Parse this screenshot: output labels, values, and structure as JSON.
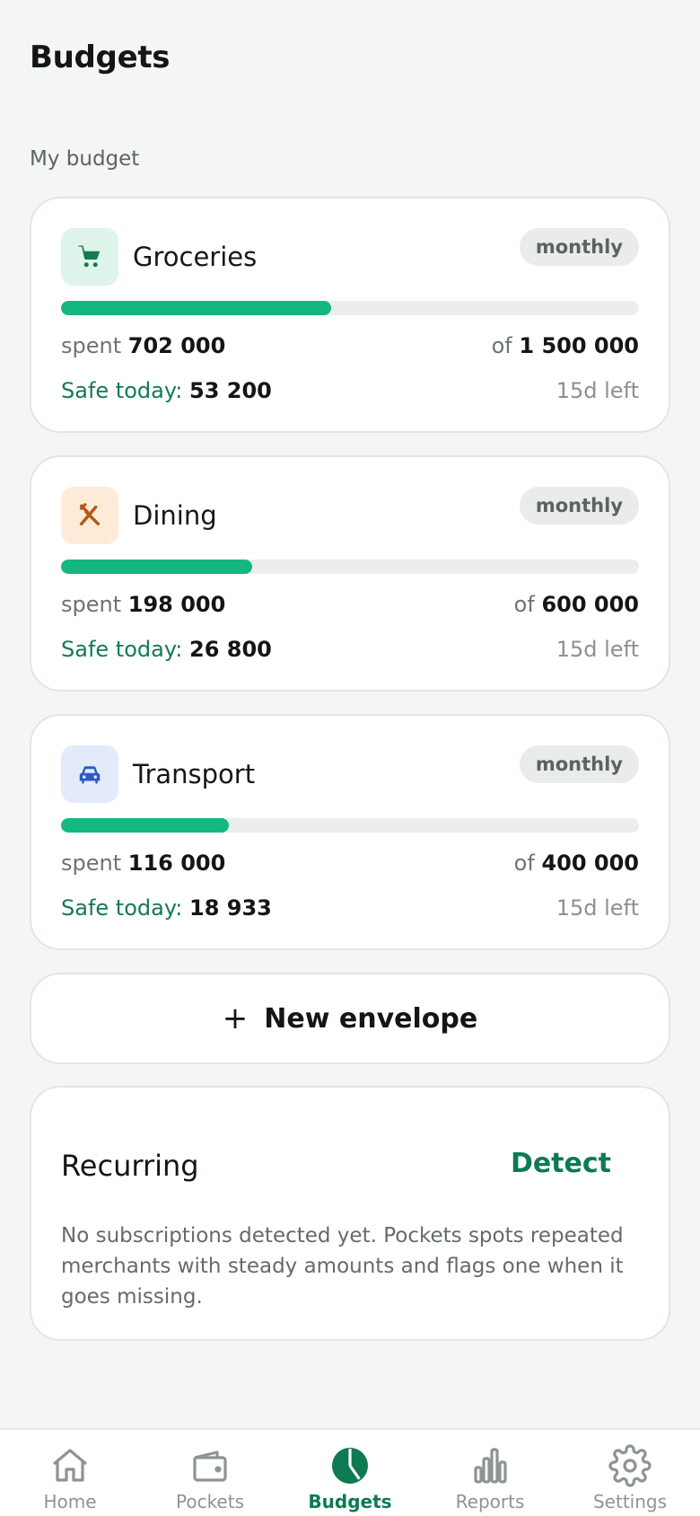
{
  "header": {
    "title": "Budgets"
  },
  "section_label": "My budget",
  "budgets": [
    {
      "name": "Groceries",
      "icon": "shopping-cart-icon",
      "icon_bg": "#dff4ea",
      "icon_color": "#137a52",
      "period": "monthly",
      "progress": 0.468,
      "spent_prefix": "spent",
      "spent": "702 000",
      "total_prefix": "of",
      "total": "1 500 000",
      "safe_label": "Safe today:",
      "safe_value": "53 200",
      "days_left": "15d left"
    },
    {
      "name": "Dining",
      "icon": "fork-knife-icon",
      "icon_bg": "#fdebd8",
      "icon_color": "#b5581a",
      "period": "monthly",
      "progress": 0.33,
      "spent_prefix": "spent",
      "spent": "198 000",
      "total_prefix": "of",
      "total": "600 000",
      "safe_label": "Safe today:",
      "safe_value": "26 800",
      "days_left": "15d left"
    },
    {
      "name": "Transport",
      "icon": "car-icon",
      "icon_bg": "#e3ebfb",
      "icon_color": "#2d5bc6",
      "period": "monthly",
      "progress": 0.29,
      "spent_prefix": "spent",
      "spent": "116 000",
      "total_prefix": "of",
      "total": "400 000",
      "safe_label": "Safe today:",
      "safe_value": "18 933",
      "days_left": "15d left"
    }
  ],
  "new_envelope": {
    "icon": "plus-icon",
    "label": "New envelope"
  },
  "recurring": {
    "title": "Recurring",
    "action": "Detect",
    "description": "No subscriptions detected yet. Pockets spots repeated merchants with steady amounts and flags one when it goes missing."
  },
  "nav": [
    {
      "label": "Home",
      "icon": "home-icon",
      "active": false
    },
    {
      "label": "Pockets",
      "icon": "wallet-icon",
      "active": false
    },
    {
      "label": "Budgets",
      "icon": "pie-chart-icon",
      "active": true
    },
    {
      "label": "Reports",
      "icon": "bar-chart-icon",
      "active": false
    },
    {
      "label": "Settings",
      "icon": "gear-icon",
      "active": false
    }
  ],
  "colors": {
    "accent": "#0d7a52",
    "progress": "#14b77f",
    "background": "#f4f6f4"
  }
}
